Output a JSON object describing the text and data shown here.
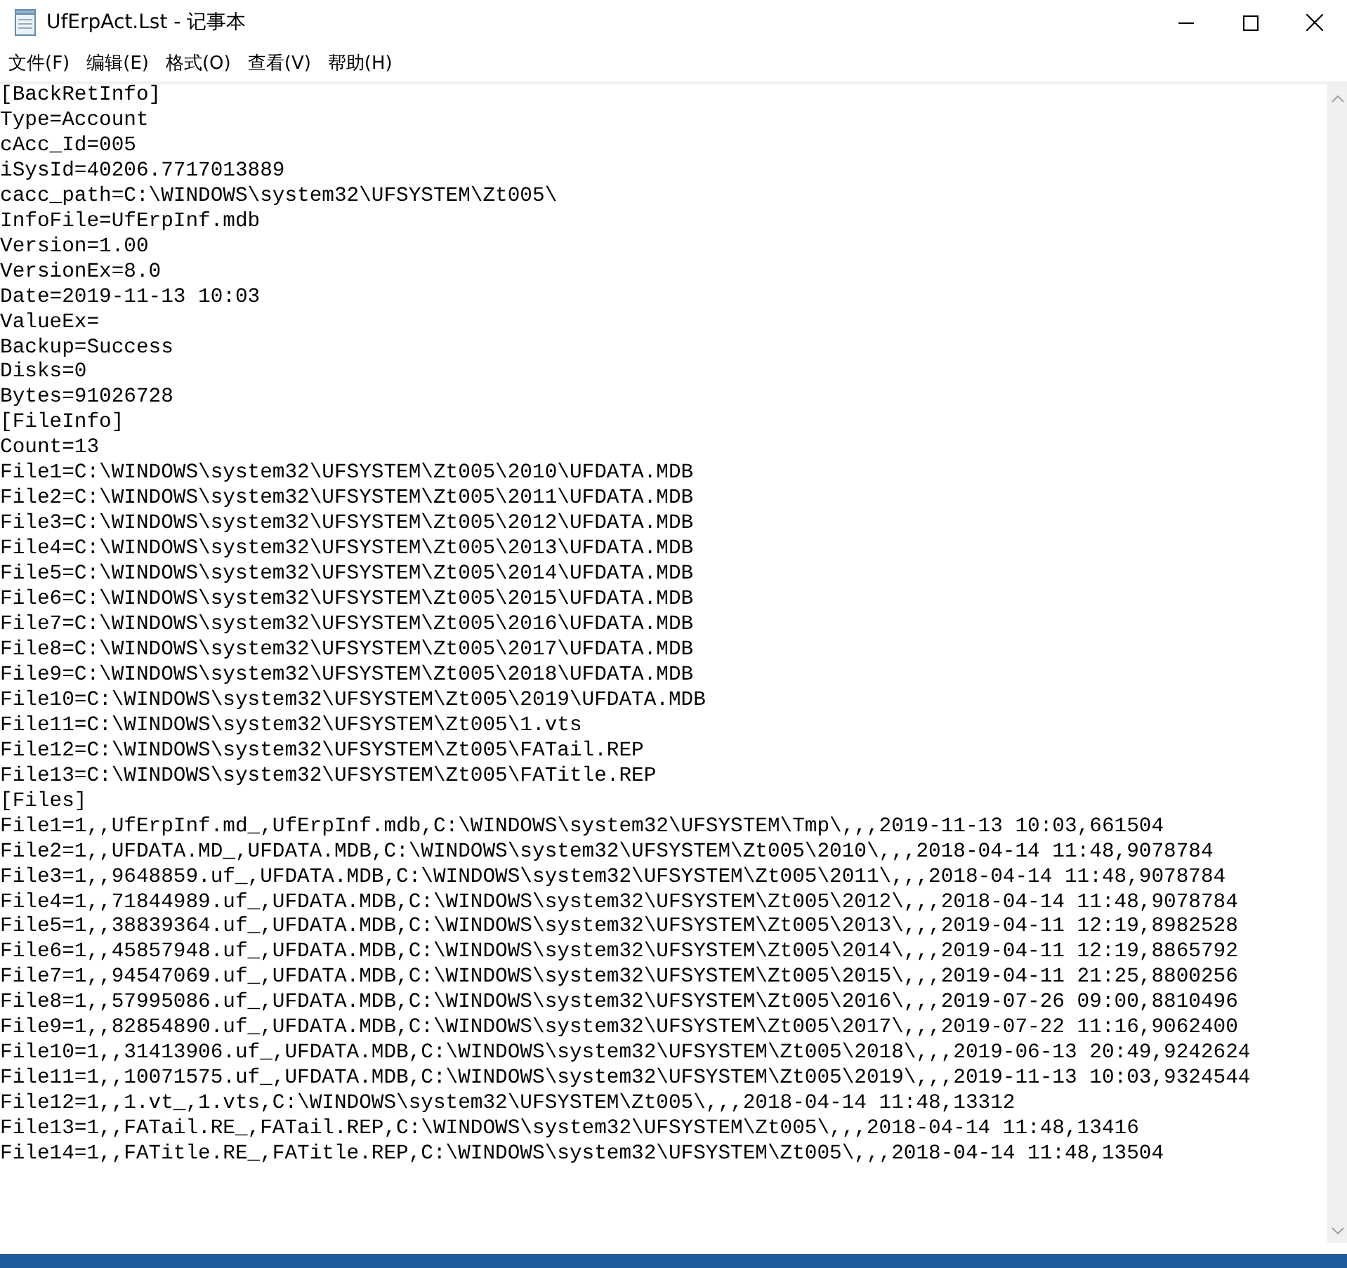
{
  "window": {
    "title": "UfErpAct.Lst - 记事本"
  },
  "menu": [
    {
      "label": "文件(F)"
    },
    {
      "label": "编辑(E)"
    },
    {
      "label": "格式(O)"
    },
    {
      "label": "查看(V)"
    },
    {
      "label": "帮助(H)"
    }
  ],
  "editor": {
    "lines": [
      "[BackRetInfo]",
      "Type=Account",
      "cAcc_Id=005",
      "iSysId=40206.7717013889",
      "cacc_path=C:\\WINDOWS\\system32\\UFSYSTEM\\Zt005\\",
      "InfoFile=UfErpInf.mdb",
      "Version=1.00",
      "VersionEx=8.0",
      "Date=2019-11-13 10:03",
      "ValueEx=",
      "Backup=Success",
      "Disks=0",
      "Bytes=91026728",
      "[FileInfo]",
      "Count=13",
      "File1=C:\\WINDOWS\\system32\\UFSYSTEM\\Zt005\\2010\\UFDATA.MDB",
      "File2=C:\\WINDOWS\\system32\\UFSYSTEM\\Zt005\\2011\\UFDATA.MDB",
      "File3=C:\\WINDOWS\\system32\\UFSYSTEM\\Zt005\\2012\\UFDATA.MDB",
      "File4=C:\\WINDOWS\\system32\\UFSYSTEM\\Zt005\\2013\\UFDATA.MDB",
      "File5=C:\\WINDOWS\\system32\\UFSYSTEM\\Zt005\\2014\\UFDATA.MDB",
      "File6=C:\\WINDOWS\\system32\\UFSYSTEM\\Zt005\\2015\\UFDATA.MDB",
      "File7=C:\\WINDOWS\\system32\\UFSYSTEM\\Zt005\\2016\\UFDATA.MDB",
      "File8=C:\\WINDOWS\\system32\\UFSYSTEM\\Zt005\\2017\\UFDATA.MDB",
      "File9=C:\\WINDOWS\\system32\\UFSYSTEM\\Zt005\\2018\\UFDATA.MDB",
      "File10=C:\\WINDOWS\\system32\\UFSYSTEM\\Zt005\\2019\\UFDATA.MDB",
      "File11=C:\\WINDOWS\\system32\\UFSYSTEM\\Zt005\\1.vts",
      "File12=C:\\WINDOWS\\system32\\UFSYSTEM\\Zt005\\FATail.REP",
      "File13=C:\\WINDOWS\\system32\\UFSYSTEM\\Zt005\\FATitle.REP",
      "[Files]",
      "File1=1,,UfErpInf.md_,UfErpInf.mdb,C:\\WINDOWS\\system32\\UFSYSTEM\\Tmp\\,,,2019-11-13 10:03,661504",
      "File2=1,,UFDATA.MD_,UFDATA.MDB,C:\\WINDOWS\\system32\\UFSYSTEM\\Zt005\\2010\\,,,2018-04-14 11:48,9078784",
      "File3=1,,9648859.uf_,UFDATA.MDB,C:\\WINDOWS\\system32\\UFSYSTEM\\Zt005\\2011\\,,,2018-04-14 11:48,9078784",
      "File4=1,,71844989.uf_,UFDATA.MDB,C:\\WINDOWS\\system32\\UFSYSTEM\\Zt005\\2012\\,,,2018-04-14 11:48,9078784",
      "File5=1,,38839364.uf_,UFDATA.MDB,C:\\WINDOWS\\system32\\UFSYSTEM\\Zt005\\2013\\,,,2019-04-11 12:19,8982528",
      "File6=1,,45857948.uf_,UFDATA.MDB,C:\\WINDOWS\\system32\\UFSYSTEM\\Zt005\\2014\\,,,2019-04-11 12:19,8865792",
      "File7=1,,94547069.uf_,UFDATA.MDB,C:\\WINDOWS\\system32\\UFSYSTEM\\Zt005\\2015\\,,,2019-04-11 21:25,8800256",
      "File8=1,,57995086.uf_,UFDATA.MDB,C:\\WINDOWS\\system32\\UFSYSTEM\\Zt005\\2016\\,,,2019-07-26 09:00,8810496",
      "File9=1,,82854890.uf_,UFDATA.MDB,C:\\WINDOWS\\system32\\UFSYSTEM\\Zt005\\2017\\,,,2019-07-22 11:16,9062400",
      "File10=1,,31413906.uf_,UFDATA.MDB,C:\\WINDOWS\\system32\\UFSYSTEM\\Zt005\\2018\\,,,2019-06-13 20:49,9242624",
      "File11=1,,10071575.uf_,UFDATA.MDB,C:\\WINDOWS\\system32\\UFSYSTEM\\Zt005\\2019\\,,,2019-11-13 10:03,9324544",
      "File12=1,,1.vt_,1.vts,C:\\WINDOWS\\system32\\UFSYSTEM\\Zt005\\,,,2018-04-14 11:48,13312",
      "File13=1,,FATail.RE_,FATail.REP,C:\\WINDOWS\\system32\\UFSYSTEM\\Zt005\\,,,2018-04-14 11:48,13416",
      "File14=1,,FATitle.RE_,FATitle.REP,C:\\WINDOWS\\system32\\UFSYSTEM\\Zt005\\,,,2018-04-14 11:48,13504"
    ]
  }
}
